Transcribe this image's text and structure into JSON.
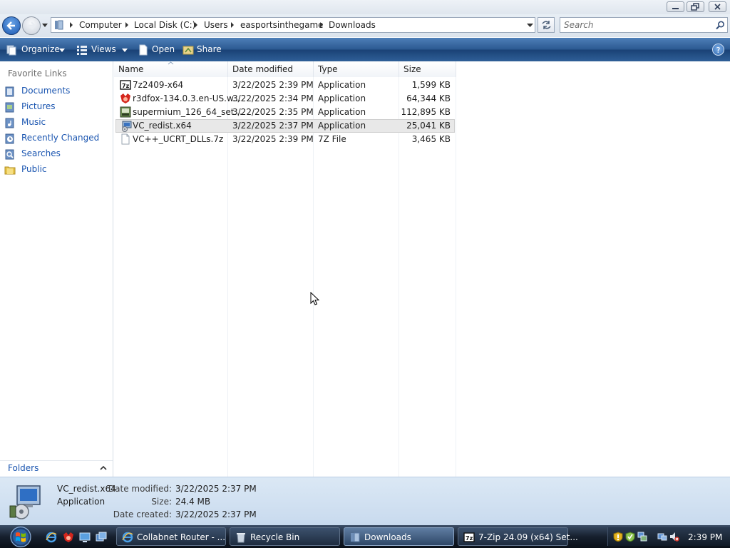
{
  "window": {
    "buttons": [
      "minimize",
      "maximize",
      "close"
    ]
  },
  "address": {
    "crumbs": [
      "Computer",
      "Local Disk (C:)",
      "Users",
      "easportsinthegame",
      "Downloads"
    ],
    "search_placeholder": "Search"
  },
  "toolbar": {
    "organize": "Organize",
    "views": "Views",
    "open": "Open",
    "share": "Share",
    "help": "?"
  },
  "nav": {
    "title": "Favorite Links",
    "items": [
      {
        "label": "Documents",
        "icon": "documents-icon"
      },
      {
        "label": "Pictures",
        "icon": "pictures-icon"
      },
      {
        "label": "Music",
        "icon": "music-icon"
      },
      {
        "label": "Recently Changed",
        "icon": "recently-changed-icon"
      },
      {
        "label": "Searches",
        "icon": "searches-icon"
      },
      {
        "label": "Public",
        "icon": "public-folder-icon"
      }
    ],
    "folders": "Folders"
  },
  "columns": [
    "Name",
    "Date modified",
    "Type",
    "Size"
  ],
  "files": [
    {
      "name": "7z2409-x64",
      "date": "3/22/2025 2:39 PM",
      "type": "Application",
      "size": "1,599 KB",
      "icon": "7zip-icon"
    },
    {
      "name": "r3dfox-134.0.3.en-US.w...",
      "date": "3/22/2025 2:34 PM",
      "type": "Application",
      "size": "64,344 KB",
      "icon": "r3dfox-icon"
    },
    {
      "name": "supermium_126_64_set...",
      "date": "3/22/2025 2:35 PM",
      "type": "Application",
      "size": "112,895 KB",
      "icon": "supermium-icon"
    },
    {
      "name": "VC_redist.x64",
      "date": "3/22/2025 2:37 PM",
      "type": "Application",
      "size": "25,041 KB",
      "icon": "installer-icon",
      "selected": true
    },
    {
      "name": "VC++_UCRT_DLLs.7z",
      "date": "3/22/2025 2:39 PM",
      "type": "7Z File",
      "size": "3,465 KB",
      "icon": "blank-file-icon"
    }
  ],
  "details": {
    "name": "VC_redist.x64",
    "type": "Application",
    "date_modified_label": "Date modified:",
    "date_modified": "3/22/2025 2:37 PM",
    "size_label": "Size:",
    "size": "24.4 MB",
    "date_created_label": "Date created:",
    "date_created": "3/22/2025 2:37 PM"
  },
  "taskbar": {
    "buttons": [
      {
        "label": "Collabnet Router - ...",
        "icon": "ie-icon"
      },
      {
        "label": "Recycle Bin",
        "icon": "recycle-bin-icon"
      },
      {
        "label": "Downloads",
        "icon": "folder-icon",
        "active": true
      },
      {
        "label": "7-Zip 24.09 (x64) Set...",
        "icon": "7zip-icon"
      }
    ],
    "clock": "2:39 PM"
  }
}
